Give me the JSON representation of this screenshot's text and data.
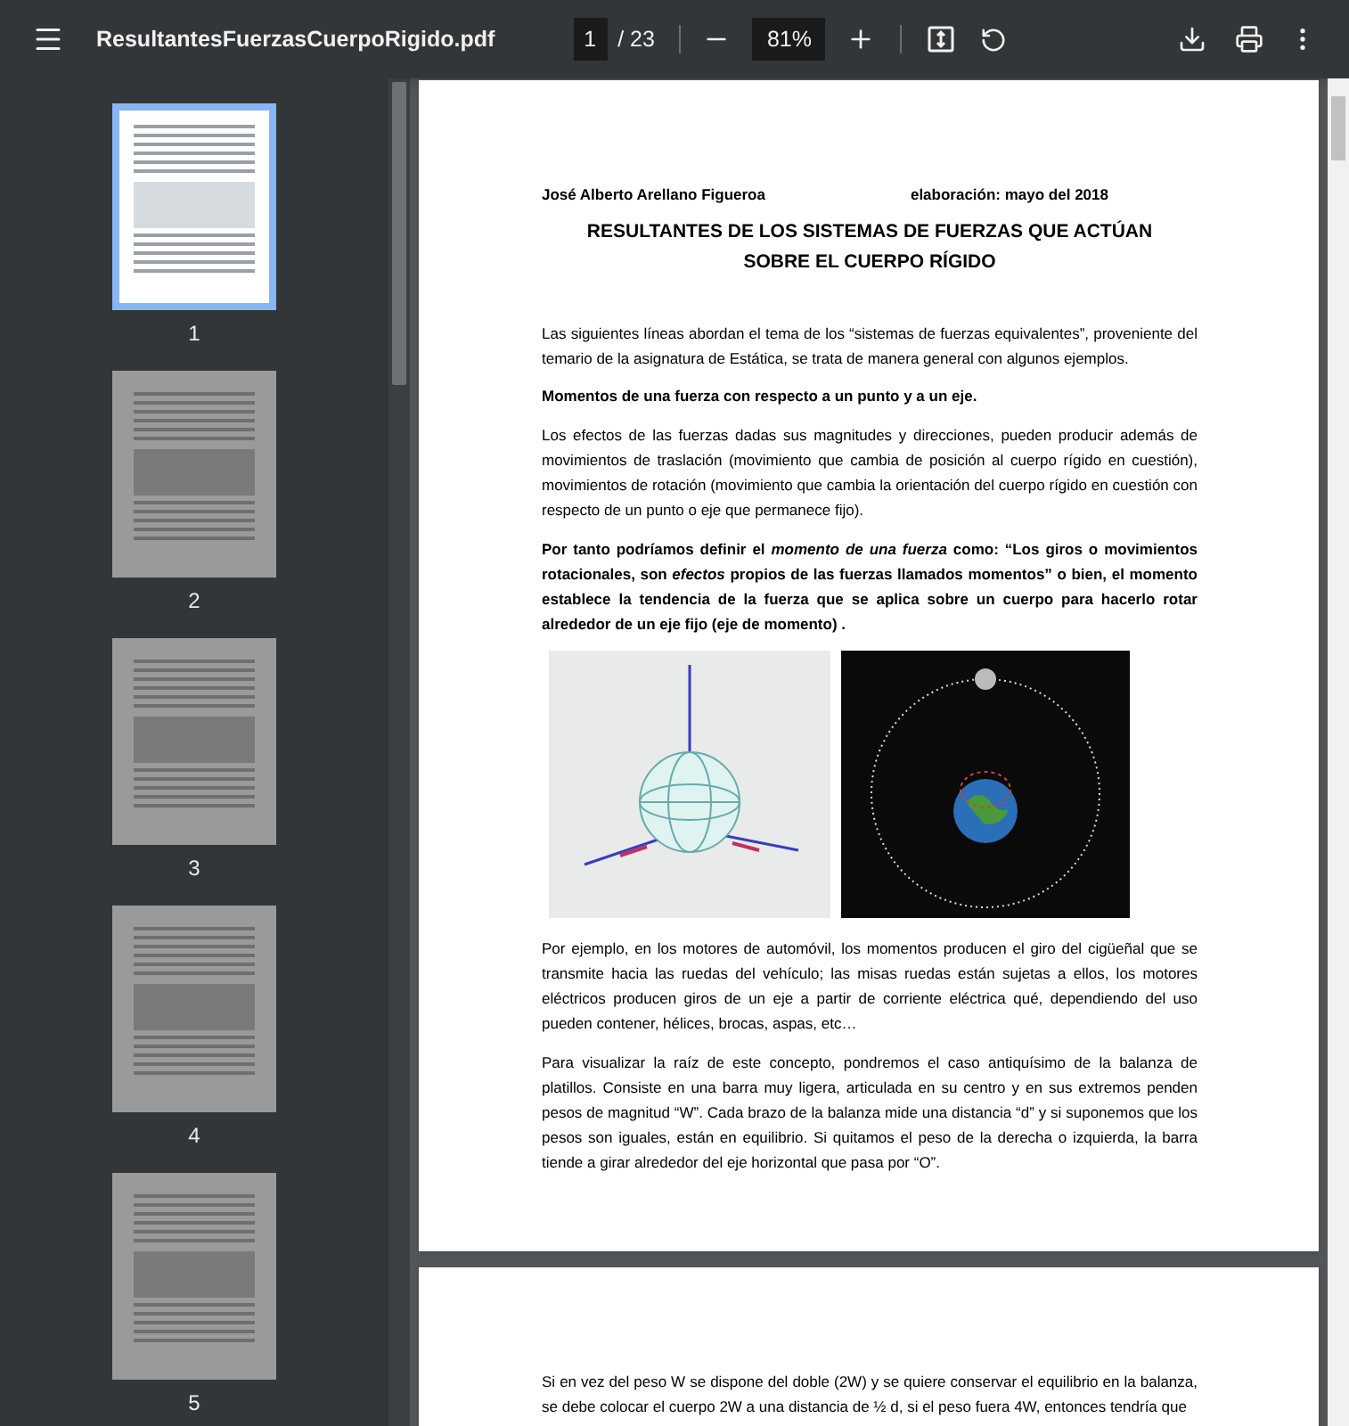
{
  "toolbar": {
    "file_name": "ResultantesFuerzasCuerpoRigido.pdf",
    "page_number": "1",
    "page_total": "/ 23",
    "zoom": "81%"
  },
  "sidebar": {
    "thumbnails": [
      {
        "label": "1",
        "selected": true
      },
      {
        "label": "2",
        "selected": false
      },
      {
        "label": "3",
        "selected": false
      },
      {
        "label": "4",
        "selected": false
      },
      {
        "label": "5",
        "selected": false
      }
    ]
  },
  "pages": [
    {
      "blocks": [
        {
          "kind": "header",
          "left": "José Alberto Arellano Figueroa",
          "right": "elaboración: mayo del 2018"
        },
        {
          "kind": "title",
          "text": "RESULTANTES DE LOS SISTEMAS DE FUERZAS QUE ACTÚAN SOBRE EL CUERPO RÍGIDO"
        },
        {
          "kind": "paragraph",
          "text": "Las siguientes líneas abordan el tema de los “sistemas de fuerzas equivalentes”, proveniente del temario de la asignatura de Estática, se trata de manera general con algunos ejemplos."
        },
        {
          "kind": "heading",
          "text": "Momentos de una fuerza con respecto a un punto y a un eje."
        },
        {
          "kind": "paragraph",
          "text": "Los efectos de las fuerzas dadas sus magnitudes y direcciones, pueden producir además de movimientos de traslación (movimiento que cambia de posición al cuerpo rígido en cuestión), movimientos de rotación (movimiento que cambia la orientación del cuerpo rígido en cuestión con respecto de un punto o eje que permanece fijo)."
        },
        {
          "kind": "bold_paragraph",
          "text": "Por tanto podríamos definir el *momento de una fuerza* como: “Los giros o movimientos rotacionales, son *efectos* propios de las fuerzas llamados momentos” o bien, el momento establece la tendencia de la fuerza que se aplica sobre un cuerpo para hacerlo rotar alrededor de un eje fijo (eje de momento) ."
        },
        {
          "kind": "figures"
        },
        {
          "kind": "paragraph",
          "text": "Por ejemplo, en los motores de automóvil, los momentos producen el giro del cigüeñal que se transmite hacia las ruedas del vehículo; las misas ruedas están sujetas a ellos, los motores eléctricos producen giros de un eje a partir de corriente eléctrica qué, dependiendo del uso pueden contener, hélices, brocas, aspas, etc…"
        },
        {
          "kind": "paragraph",
          "text": "Para visualizar la raíz de este concepto, pondremos el caso antiquísimo de la balanza de platillos. Consiste en una barra muy ligera, articulada en su centro y en sus extremos penden pesos de magnitud “W”. Cada brazo de la balanza mide una distancia “d” y si suponemos que los pesos son iguales, están en equilibrio. Si quitamos el peso de la derecha o izquierda, la barra tiende a girar alrededor del eje horizontal que pasa por “O”."
        }
      ]
    },
    {
      "blocks": [
        {
          "kind": "paragraph",
          "text": "Si en vez del peso W se dispone del doble (2W) y se quiere conservar el equilibrio en la balanza, se debe colocar el cuerpo 2W a una distancia de ½ d, si el peso fuera 4W, entonces tendría que"
        }
      ]
    }
  ]
}
